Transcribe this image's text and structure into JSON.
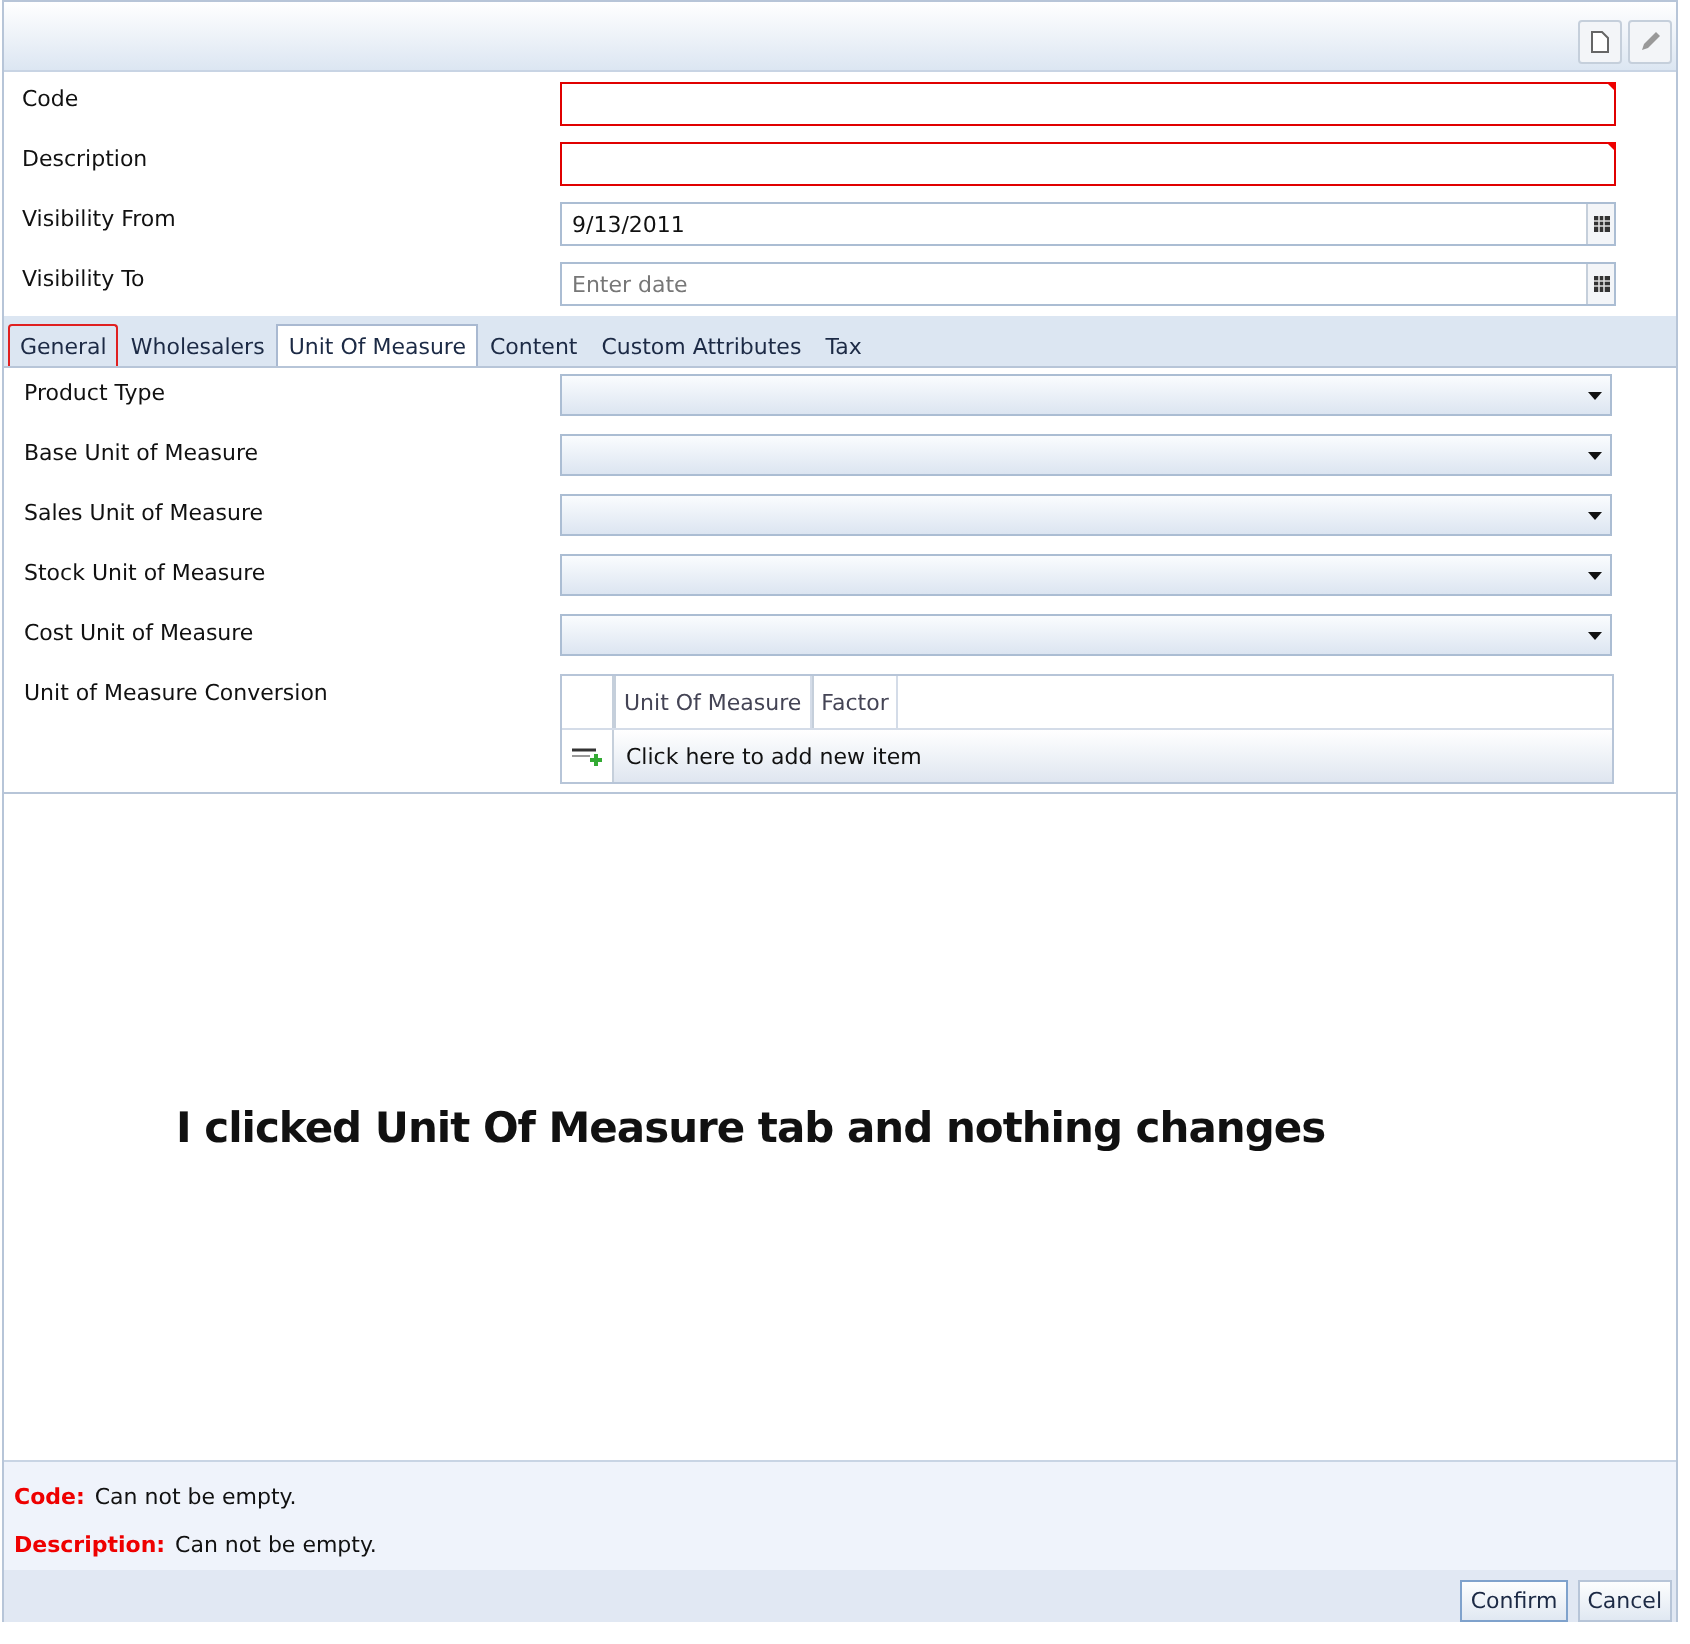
{
  "fields": [
    {
      "label": "Code",
      "kind": "text",
      "invalid": true
    },
    {
      "label": "Description",
      "kind": "text",
      "invalid": true
    },
    {
      "label": "Visibility From",
      "kind": "date",
      "value": "9/13/2011",
      "invalid": false
    },
    {
      "label": "Visibility To",
      "kind": "date",
      "placeholder": "Enter date",
      "invalid": false
    }
  ],
  "tabs": [
    {
      "label": "General",
      "selected": false,
      "invalid": true
    },
    {
      "label": "Wholesalers",
      "selected": false,
      "invalid": false
    },
    {
      "label": "Unit Of Measure",
      "selected": true,
      "invalid": false
    },
    {
      "label": "Content",
      "selected": false,
      "invalid": false
    },
    {
      "label": "Custom Attributes",
      "selected": false,
      "invalid": false
    },
    {
      "label": "Tax",
      "selected": false,
      "invalid": false
    }
  ],
  "dropdowns": [
    {
      "label": "Product Type"
    },
    {
      "label": "Base Unit of Measure"
    },
    {
      "label": "Sales Unit of Measure"
    },
    {
      "label": "Stock Unit of Measure"
    },
    {
      "label": "Cost Unit of Measure"
    }
  ],
  "conversion": {
    "label": "Unit of Measure Conversion",
    "columns": [
      "Unit Of Measure",
      "Factor"
    ],
    "add_row": "Click here to add new item"
  },
  "annotation": "I clicked Unit Of Measure tab and nothing changes",
  "errors": [
    {
      "field": "Code:",
      "message": "Can not be empty."
    },
    {
      "field": "Description:",
      "message": "Can not be empty."
    }
  ],
  "buttons": [
    "Confirm",
    "Cancel"
  ]
}
